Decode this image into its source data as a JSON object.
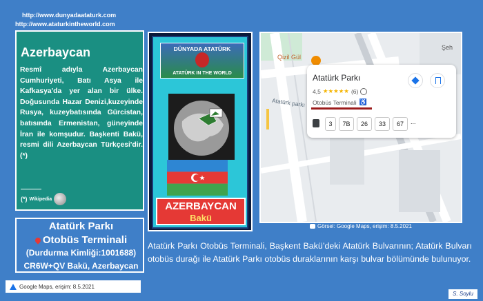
{
  "header": {
    "url1": "http://www.dunyadaataturk.com",
    "url2": "http://www.ataturkintheworld.com"
  },
  "country": {
    "title": "Azerbaycan",
    "description": "Resmî adıyla Azerbaycan Cumhuriyeti, Batı Asya ile Kafkasya'da yer alan bir ülke. Doğusunda Hazar Denizi,kuzeyinde Rusya, kuzeybatısında Gürcistan, batısında Ermenistan, güneyinde İran ile komşudur. Başkenti Bakü, resmi dili Azerbaycan Türkçesi'dir.(*)",
    "source_mark": "(*)",
    "source_name": "Wikipedia"
  },
  "place": {
    "title_line1": "Atatürk Parkı",
    "title_line2": "Otobüs Terminali",
    "id_line": "(Durdurma Kimliği:1001688)",
    "code_line": "CR6W+QV Bakü, Azerbaycan"
  },
  "footer": {
    "left_caption": "Google Maps, erişim: 8.5.2021",
    "map_caption": "Görsel: Google Maps, erişim: 8.5.2021",
    "signature": "S. Soylu"
  },
  "poster": {
    "banner_top": "DÜNYADA ATATÜRK",
    "banner_bottom": "ATATÜRK IN THE WORLD",
    "label_country": "AZERBAYCAN",
    "label_city": "Bakü"
  },
  "map": {
    "label_sehir": "Şeh",
    "label_restaurant": "Qizil Gül",
    "label_road": "Atatürk parkı",
    "card_title": "Atatürk Parkı",
    "card_rating": "4,5",
    "card_stars": "★★★★★",
    "card_reviews": "(6)",
    "card_type": "Otobüs Terminali",
    "routes": [
      "3",
      "7B",
      "26",
      "33",
      "67",
      "..."
    ]
  },
  "description": "Atatürk Parkı Otobüs Terminali, Başkent Bakü’deki Atatürk Bulvarının; Atatürk Bulvarı otobüs durağı ile Atatürk Parkı otobüs duraklarının karşı bulvar bölümünde bulunuyor.",
  "colors": {
    "background": "#3f7fc8",
    "card_green": "#1a8f82",
    "accent_red": "#e53935"
  }
}
